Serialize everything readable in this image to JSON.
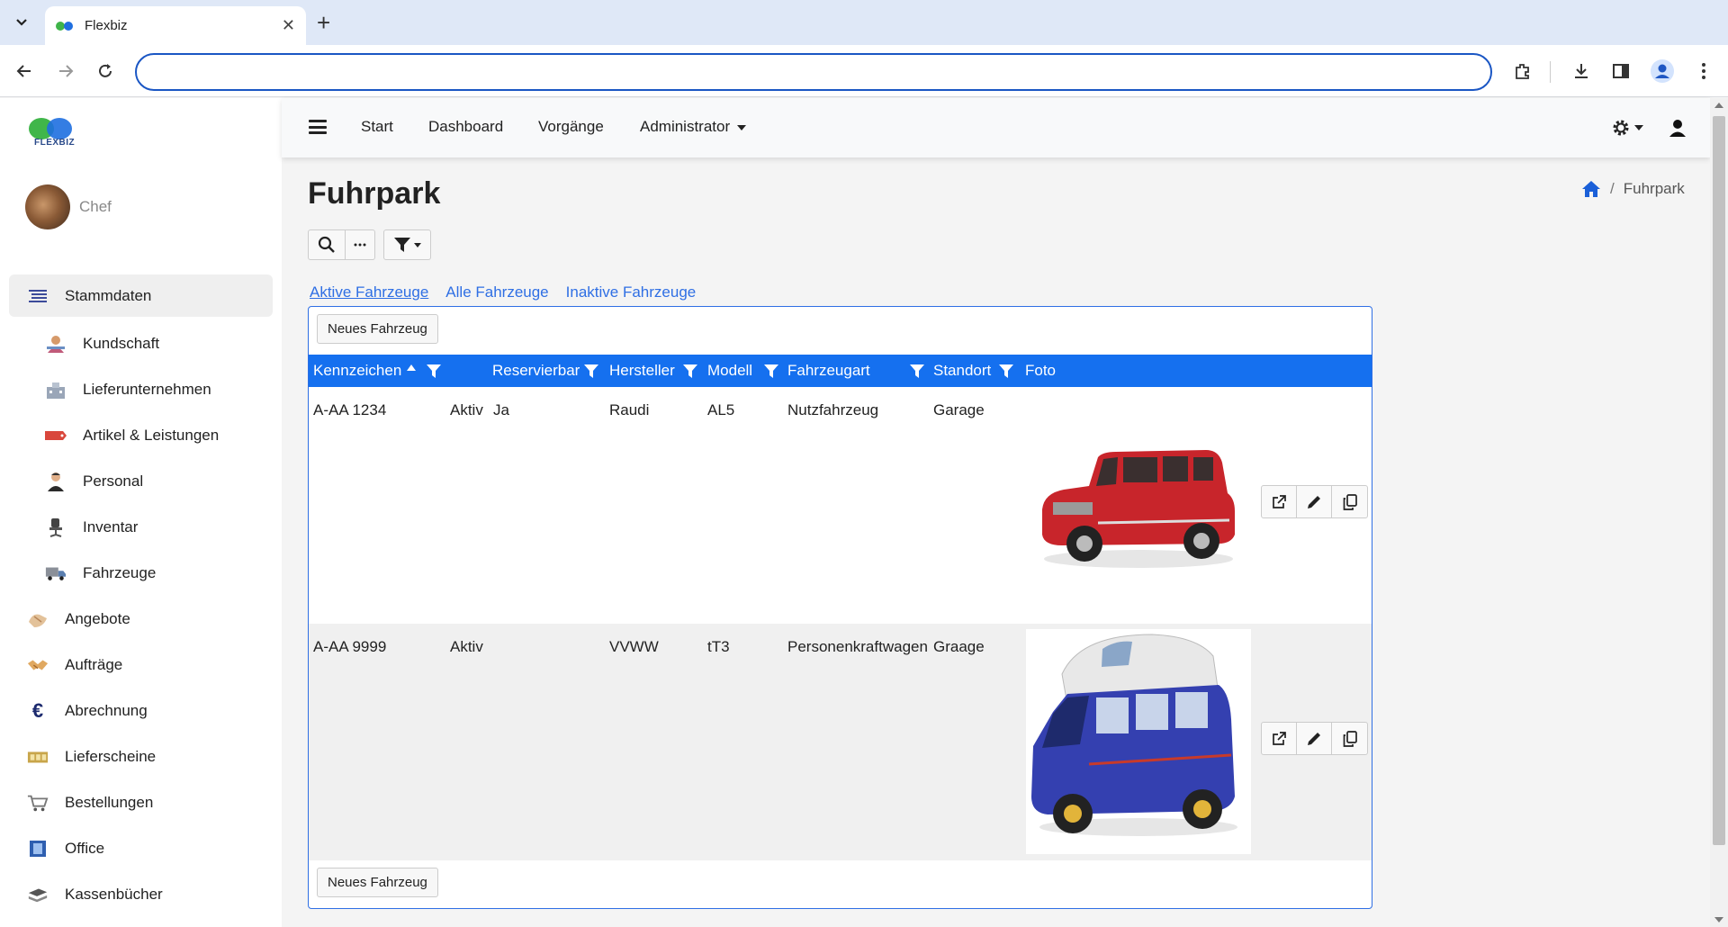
{
  "browser": {
    "tab_title": "Flexbiz",
    "url": ""
  },
  "sidebar": {
    "logo_text": "FLEXBIZ",
    "user_name": "Chef",
    "items": [
      {
        "label": "Stammdaten",
        "icon": "list-icon",
        "level": 1,
        "active": true
      },
      {
        "label": "Kundschaft",
        "icon": "customer-icon",
        "level": 2
      },
      {
        "label": "Lieferunternehmen",
        "icon": "supplier-icon",
        "level": 2
      },
      {
        "label": "Artikel & Leistungen",
        "icon": "price-tag-icon",
        "level": 2
      },
      {
        "label": "Personal",
        "icon": "staff-icon",
        "level": 2
      },
      {
        "label": "Inventar",
        "icon": "chair-icon",
        "level": 2
      },
      {
        "label": "Fahrzeuge",
        "icon": "truck-icon",
        "level": 2
      },
      {
        "label": "Angebote",
        "icon": "offer-icon",
        "level": 1
      },
      {
        "label": "Aufträge",
        "icon": "handshake-icon",
        "level": 1
      },
      {
        "label": "Abrechnung",
        "icon": "euro-icon",
        "level": 1
      },
      {
        "label": "Lieferscheine",
        "icon": "delivery-icon",
        "level": 1
      },
      {
        "label": "Bestellungen",
        "icon": "cart-icon",
        "level": 1
      },
      {
        "label": "Office",
        "icon": "office-icon",
        "level": 1
      },
      {
        "label": "Kassenbücher",
        "icon": "cashbook-icon",
        "level": 1
      }
    ]
  },
  "topnav": {
    "links": [
      "Start",
      "Dashboard",
      "Vorgänge",
      "Administrator"
    ]
  },
  "page": {
    "title": "Fuhrpark",
    "breadcrumb": "Fuhrpark",
    "tabs": [
      "Aktive Fahrzeuge",
      "Alle Fahrzeuge",
      "Inaktive Fahrzeuge"
    ],
    "new_button": "Neues Fahrzeug"
  },
  "table": {
    "columns": [
      "Kennzeichen",
      "Reservierbar",
      "Hersteller",
      "Modell",
      "Fahrzeugart",
      "Standort",
      "Foto"
    ],
    "rows": [
      {
        "kennzeichen": "A-AA 1234",
        "status": "Aktiv",
        "reservierbar": "Ja",
        "hersteller": "Raudi",
        "modell": "AL5",
        "fahrzeugart": "Nutzfahrzeug",
        "standort": "Garage",
        "photo": "red-car"
      },
      {
        "kennzeichen": "A-AA 9999",
        "status": "Aktiv",
        "reservierbar": "",
        "hersteller": "VVWW",
        "modell": "tT3",
        "fahrzeugart": "Personenkraftwagen",
        "standort": "Graage",
        "photo": "blue-van"
      }
    ]
  },
  "colors": {
    "accent": "#1570ef",
    "link": "#2f6fe4"
  }
}
